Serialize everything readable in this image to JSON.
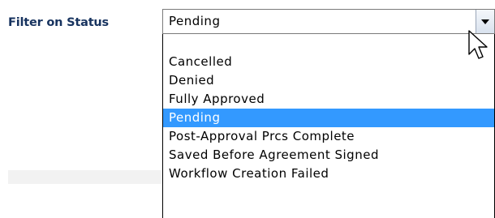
{
  "filter": {
    "label": "Filter on Status",
    "selected_value": "Pending"
  },
  "dropdown": {
    "options": [
      "",
      "Cancelled",
      "Denied",
      "Fully Approved",
      "Pending",
      "Post-Approval Prcs Complete",
      "Saved Before Agreement Signed",
      "Workflow Creation Failed"
    ],
    "highlighted_option": "Pending"
  },
  "colors": {
    "label_text": "#17335f",
    "highlight_background": "#3399ff",
    "highlight_text": "#ffffff"
  },
  "icons": {
    "dropdown_arrow": "chevron-down-icon",
    "pointer": "mouse-cursor-icon"
  }
}
